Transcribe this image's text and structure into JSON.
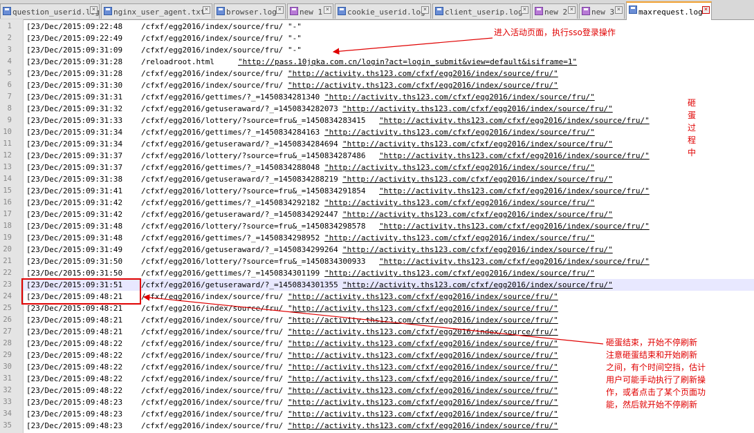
{
  "tabs": [
    {
      "label": "question_userid.log",
      "icon": "file-icon"
    },
    {
      "label": "nginx_user_agent.txt",
      "icon": "file-icon"
    },
    {
      "label": "browser.log",
      "icon": "file-icon"
    },
    {
      "label": "new 1",
      "icon": "file-modified-icon"
    },
    {
      "label": "cookie_userid.log",
      "icon": "file-icon"
    },
    {
      "label": "client_userip.log",
      "icon": "file-icon"
    },
    {
      "label": "new 2",
      "icon": "file-modified-icon"
    },
    {
      "label": "new 3",
      "icon": "file-modified-icon"
    },
    {
      "label": "maxrequest.log",
      "icon": "file-icon",
      "active": true
    }
  ],
  "lines": [
    {
      "n": "1",
      "ts": "[23/Dec/2015:09:22:48",
      "path": "/cfxf/egg2016/index/source/fru/",
      "ref": "\"-\""
    },
    {
      "n": "2",
      "ts": "[23/Dec/2015:09:22:49",
      "path": "/cfxf/egg2016/index/source/fru/",
      "ref": "\"-\""
    },
    {
      "n": "3",
      "ts": "[23/Dec/2015:09:31:09",
      "path": "/cfxf/egg2016/index/source/fru/",
      "ref": "\"-\""
    },
    {
      "n": "4",
      "ts": "[23/Dec/2015:09:31:28",
      "path": "/reloadroot.html",
      "ref": "\"http://pass.10jqka.com.cn/login?act=login_submit&view=default&isiframe=1\""
    },
    {
      "n": "5",
      "ts": "[23/Dec/2015:09:31:28",
      "path": "/cfxf/egg2016/index/source/fru/",
      "ref": "\"http://activity.ths123.com/cfxf/egg2016/index/source/fru/\""
    },
    {
      "n": "6",
      "ts": "[23/Dec/2015:09:31:30",
      "path": "/cfxf/egg2016/index/source/fru/",
      "ref": "\"http://activity.ths123.com/cfxf/egg2016/index/source/fru/\""
    },
    {
      "n": "7",
      "ts": "[23/Dec/2015:09:31:31",
      "path": "/cfxf/egg2016/gettimes/?_=1450834281340",
      "ref": "\"http://activity.ths123.com/cfxf/egg2016/index/source/fru/\""
    },
    {
      "n": "8",
      "ts": "[23/Dec/2015:09:31:32",
      "path": "/cfxf/egg2016/getuseraward/?_=1450834282073",
      "ref": "\"http://activity.ths123.com/cfxf/egg2016/index/source/fru/\""
    },
    {
      "n": "9",
      "ts": "[23/Dec/2015:09:31:33",
      "path": "/cfxf/egg2016/lottery/?source=fru&_=1450834283415",
      "ref": "\"http://activity.ths123.com/cfxf/egg2016/index/source/fru/\""
    },
    {
      "n": "10",
      "ts": "[23/Dec/2015:09:31:34",
      "path": "/cfxf/egg2016/gettimes/?_=1450834284163",
      "ref": "\"http://activity.ths123.com/cfxf/egg2016/index/source/fru/\""
    },
    {
      "n": "11",
      "ts": "[23/Dec/2015:09:31:34",
      "path": "/cfxf/egg2016/getuseraward/?_=1450834284694",
      "ref": "\"http://activity.ths123.com/cfxf/egg2016/index/source/fru/\""
    },
    {
      "n": "12",
      "ts": "[23/Dec/2015:09:31:37",
      "path": "/cfxf/egg2016/lottery/?source=fru&_=1450834287486",
      "ref": "\"http://activity.ths123.com/cfxf/egg2016/index/source/fru/\""
    },
    {
      "n": "13",
      "ts": "[23/Dec/2015:09:31:37",
      "path": "/cfxf/egg2016/gettimes/?_=1450834288048",
      "ref": "\"http://activity.ths123.com/cfxf/egg2016/index/source/fru/\""
    },
    {
      "n": "14",
      "ts": "[23/Dec/2015:09:31:38",
      "path": "/cfxf/egg2016/getuseraward/?_=1450834288219",
      "ref": "\"http://activity.ths123.com/cfxf/egg2016/index/source/fru/\""
    },
    {
      "n": "15",
      "ts": "[23/Dec/2015:09:31:41",
      "path": "/cfxf/egg2016/lottery/?source=fru&_=1450834291854",
      "ref": "\"http://activity.ths123.com/cfxf/egg2016/index/source/fru/\""
    },
    {
      "n": "16",
      "ts": "[23/Dec/2015:09:31:42",
      "path": "/cfxf/egg2016/gettimes/?_=1450834292182",
      "ref": "\"http://activity.ths123.com/cfxf/egg2016/index/source/fru/\""
    },
    {
      "n": "17",
      "ts": "[23/Dec/2015:09:31:42",
      "path": "/cfxf/egg2016/getuseraward/?_=1450834292447",
      "ref": "\"http://activity.ths123.com/cfxf/egg2016/index/source/fru/\""
    },
    {
      "n": "18",
      "ts": "[23/Dec/2015:09:31:48",
      "path": "/cfxf/egg2016/lottery/?source=fru&_=1450834298578",
      "ref": "\"http://activity.ths123.com/cfxf/egg2016/index/source/fru/\""
    },
    {
      "n": "19",
      "ts": "[23/Dec/2015:09:31:48",
      "path": "/cfxf/egg2016/gettimes/?_=1450834298952",
      "ref": "\"http://activity.ths123.com/cfxf/egg2016/index/source/fru/\""
    },
    {
      "n": "20",
      "ts": "[23/Dec/2015:09:31:49",
      "path": "/cfxf/egg2016/getuseraward/?_=1450834299264",
      "ref": "\"http://activity.ths123.com/cfxf/egg2016/index/source/fru/\""
    },
    {
      "n": "21",
      "ts": "[23/Dec/2015:09:31:50",
      "path": "/cfxf/egg2016/lottery/?source=fru&_=1450834300933",
      "ref": "\"http://activity.ths123.com/cfxf/egg2016/index/source/fru/\""
    },
    {
      "n": "22",
      "ts": "[23/Dec/2015:09:31:50",
      "path": "/cfxf/egg2016/gettimes/?_=1450834301199",
      "ref": "\"http://activity.ths123.com/cfxf/egg2016/index/source/fru/\""
    },
    {
      "n": "23",
      "ts": "[23/Dec/2015:09:31:51",
      "path": "/cfxf/egg2016/getuseraward/?_=1450834301355",
      "ref": "\"http://activity.ths123.com/cfxf/egg2016/index/source/fru/\"",
      "current": true
    },
    {
      "n": "24",
      "ts": "[23/Dec/2015:09:48:21",
      "path": "/cfxf/egg2016/index/source/fru/",
      "ref": "\"http://activity.ths123.com/cfxf/egg2016/index/source/fru/\""
    },
    {
      "n": "25",
      "ts": "[23/Dec/2015:09:48:21",
      "path": "/cfxf/egg2016/index/source/fru/",
      "ref": "\"http://activity.ths123.com/cfxf/egg2016/index/source/fru/\""
    },
    {
      "n": "26",
      "ts": "[23/Dec/2015:09:48:21",
      "path": "/cfxf/egg2016/index/source/fru/",
      "ref": "\"http://activity.ths123.com/cfxf/egg2016/index/source/fru/\""
    },
    {
      "n": "27",
      "ts": "[23/Dec/2015:09:48:21",
      "path": "/cfxf/egg2016/index/source/fru/",
      "ref": "\"http://activity.ths123.com/cfxf/egg2016/index/source/fru/\""
    },
    {
      "n": "28",
      "ts": "[23/Dec/2015:09:48:22",
      "path": "/cfxf/egg2016/index/source/fru/",
      "ref": "\"http://activity.ths123.com/cfxf/egg2016/index/source/fru/\""
    },
    {
      "n": "29",
      "ts": "[23/Dec/2015:09:48:22",
      "path": "/cfxf/egg2016/index/source/fru/",
      "ref": "\"http://activity.ths123.com/cfxf/egg2016/index/source/fru/\""
    },
    {
      "n": "30",
      "ts": "[23/Dec/2015:09:48:22",
      "path": "/cfxf/egg2016/index/source/fru/",
      "ref": "\"http://activity.ths123.com/cfxf/egg2016/index/source/fru/\""
    },
    {
      "n": "31",
      "ts": "[23/Dec/2015:09:48:22",
      "path": "/cfxf/egg2016/index/source/fru/",
      "ref": "\"http://activity.ths123.com/cfxf/egg2016/index/source/fru/\""
    },
    {
      "n": "32",
      "ts": "[23/Dec/2015:09:48:22",
      "path": "/cfxf/egg2016/index/source/fru/",
      "ref": "\"http://activity.ths123.com/cfxf/egg2016/index/source/fru/\""
    },
    {
      "n": "33",
      "ts": "[23/Dec/2015:09:48:23",
      "path": "/cfxf/egg2016/index/source/fru/",
      "ref": "\"http://activity.ths123.com/cfxf/egg2016/index/source/fru/\""
    },
    {
      "n": "34",
      "ts": "[23/Dec/2015:09:48:23",
      "path": "/cfxf/egg2016/index/source/fru/",
      "ref": "\"http://activity.ths123.com/cfxf/egg2016/index/source/fru/\""
    },
    {
      "n": "35",
      "ts": "[23/Dec/2015:09:48:23",
      "path": "/cfxf/egg2016/index/source/fru/",
      "ref": "\"http://activity.ths123.com/cfxf/egg2016/index/source/fru/\""
    }
  ],
  "annotations": {
    "sso_note": "进入活动页面，执行sso登录操作",
    "smashing_note": "砸蛋过程中",
    "refresh_note": [
      "砸蛋结束，开始不停刷新",
      "注意砸蛋结束和开始刷新",
      "之间，有个时间空挡，估计",
      "用户可能手动执行了刷新操",
      "作，或者点击了某个页面功",
      "能，然后就开始不停刷新"
    ]
  },
  "colors": {
    "annotation": "#e00000",
    "tab_active_accent": "#f0a030",
    "gutter_bg": "#e4e4e4"
  }
}
